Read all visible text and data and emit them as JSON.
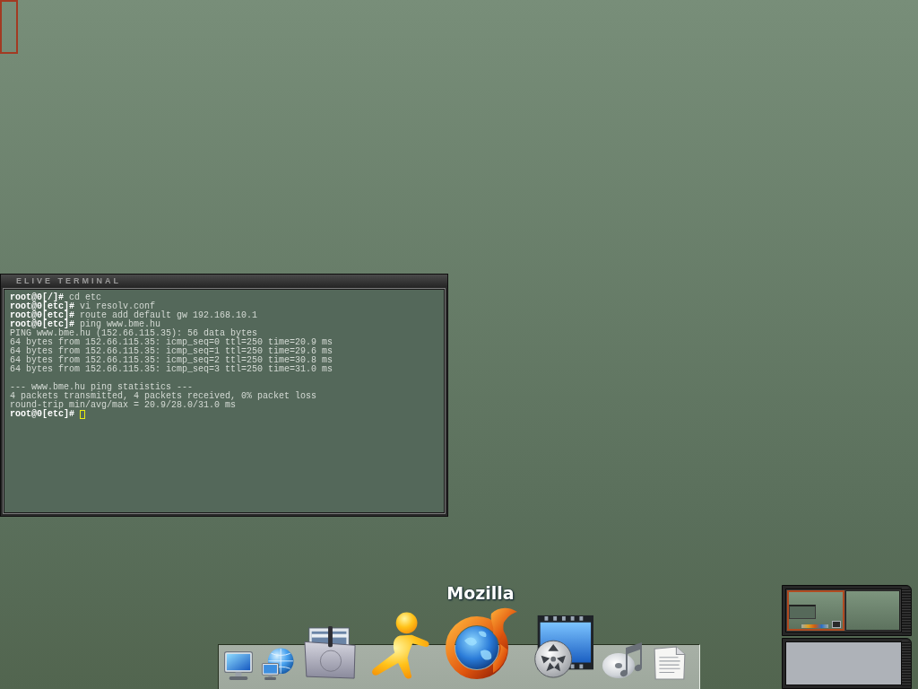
{
  "terminal": {
    "title": "ELIVE TERMINAL",
    "lines": [
      {
        "kind": "prompt",
        "prompt": "root@0[/]#",
        "command": "cd etc",
        "cursor": false
      },
      {
        "kind": "prompt",
        "prompt": "root@0[etc]#",
        "command": "vi resolv.conf",
        "cursor": false
      },
      {
        "kind": "prompt",
        "prompt": "root@0[etc]#",
        "command": "route add default gw 192.168.10.1",
        "cursor": false
      },
      {
        "kind": "prompt",
        "prompt": "root@0[etc]#",
        "command": "ping www.bme.hu",
        "cursor": false
      },
      {
        "kind": "output",
        "text": "PING www.bme.hu (152.66.115.35): 56 data bytes",
        "cursor": false
      },
      {
        "kind": "output",
        "text": "64 bytes from 152.66.115.35: icmp_seq=0 ttl=250 time=20.9 ms",
        "cursor": false
      },
      {
        "kind": "output",
        "text": "64 bytes from 152.66.115.35: icmp_seq=1 ttl=250 time=29.6 ms",
        "cursor": false
      },
      {
        "kind": "output",
        "text": "64 bytes from 152.66.115.35: icmp_seq=2 ttl=250 time=30.8 ms",
        "cursor": false
      },
      {
        "kind": "output",
        "text": "64 bytes from 152.66.115.35: icmp_seq=3 ttl=250 time=31.0 ms",
        "cursor": false
      },
      {
        "kind": "blank"
      },
      {
        "kind": "output",
        "text": "--- www.bme.hu ping statistics ---",
        "cursor": false
      },
      {
        "kind": "output",
        "text": "4 packets transmitted, 4 packets received, 0% packet loss",
        "cursor": false
      },
      {
        "kind": "output",
        "text": "round-trip min/avg/max = 20.9/28.0/31.0 ms",
        "cursor": false
      },
      {
        "kind": "prompt",
        "prompt": "root@0[etc]#",
        "cursor": true
      }
    ]
  },
  "dock": {
    "items": [
      {
        "kind": "monitor",
        "hovered": false
      },
      {
        "kind": "network",
        "hovered": false
      },
      {
        "kind": "folder",
        "hovered": false
      },
      {
        "kind": "messenger",
        "hovered": false
      },
      {
        "kind": "browser",
        "hovered": true,
        "label": "Mozilla"
      },
      {
        "kind": "video",
        "hovered": false
      },
      {
        "kind": "music",
        "hovered": false
      },
      {
        "kind": "document",
        "hovered": false
      }
    ]
  },
  "pager": {
    "desks": [
      {
        "selected": true
      },
      {
        "selected": false
      }
    ]
  }
}
